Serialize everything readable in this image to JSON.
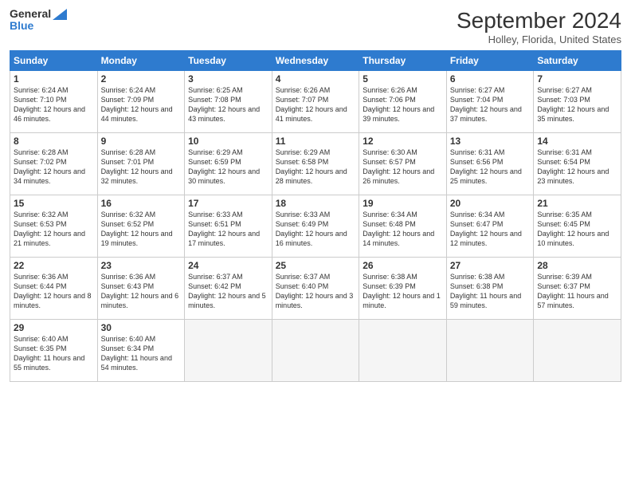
{
  "logo": {
    "line1": "General",
    "line2": "Blue"
  },
  "title": "September 2024",
  "location": "Holley, Florida, United States",
  "days_of_week": [
    "Sunday",
    "Monday",
    "Tuesday",
    "Wednesday",
    "Thursday",
    "Friday",
    "Saturday"
  ],
  "weeks": [
    [
      {
        "day": "1",
        "sunrise": "6:24 AM",
        "sunset": "7:10 PM",
        "daylight": "12 hours and 46 minutes."
      },
      {
        "day": "2",
        "sunrise": "6:24 AM",
        "sunset": "7:09 PM",
        "daylight": "12 hours and 44 minutes."
      },
      {
        "day": "3",
        "sunrise": "6:25 AM",
        "sunset": "7:08 PM",
        "daylight": "12 hours and 43 minutes."
      },
      {
        "day": "4",
        "sunrise": "6:26 AM",
        "sunset": "7:07 PM",
        "daylight": "12 hours and 41 minutes."
      },
      {
        "day": "5",
        "sunrise": "6:26 AM",
        "sunset": "7:06 PM",
        "daylight": "12 hours and 39 minutes."
      },
      {
        "day": "6",
        "sunrise": "6:27 AM",
        "sunset": "7:04 PM",
        "daylight": "12 hours and 37 minutes."
      },
      {
        "day": "7",
        "sunrise": "6:27 AM",
        "sunset": "7:03 PM",
        "daylight": "12 hours and 35 minutes."
      }
    ],
    [
      {
        "day": "8",
        "sunrise": "6:28 AM",
        "sunset": "7:02 PM",
        "daylight": "12 hours and 34 minutes."
      },
      {
        "day": "9",
        "sunrise": "6:28 AM",
        "sunset": "7:01 PM",
        "daylight": "12 hours and 32 minutes."
      },
      {
        "day": "10",
        "sunrise": "6:29 AM",
        "sunset": "6:59 PM",
        "daylight": "12 hours and 30 minutes."
      },
      {
        "day": "11",
        "sunrise": "6:29 AM",
        "sunset": "6:58 PM",
        "daylight": "12 hours and 28 minutes."
      },
      {
        "day": "12",
        "sunrise": "6:30 AM",
        "sunset": "6:57 PM",
        "daylight": "12 hours and 26 minutes."
      },
      {
        "day": "13",
        "sunrise": "6:31 AM",
        "sunset": "6:56 PM",
        "daylight": "12 hours and 25 minutes."
      },
      {
        "day": "14",
        "sunrise": "6:31 AM",
        "sunset": "6:54 PM",
        "daylight": "12 hours and 23 minutes."
      }
    ],
    [
      {
        "day": "15",
        "sunrise": "6:32 AM",
        "sunset": "6:53 PM",
        "daylight": "12 hours and 21 minutes."
      },
      {
        "day": "16",
        "sunrise": "6:32 AM",
        "sunset": "6:52 PM",
        "daylight": "12 hours and 19 minutes."
      },
      {
        "day": "17",
        "sunrise": "6:33 AM",
        "sunset": "6:51 PM",
        "daylight": "12 hours and 17 minutes."
      },
      {
        "day": "18",
        "sunrise": "6:33 AM",
        "sunset": "6:49 PM",
        "daylight": "12 hours and 16 minutes."
      },
      {
        "day": "19",
        "sunrise": "6:34 AM",
        "sunset": "6:48 PM",
        "daylight": "12 hours and 14 minutes."
      },
      {
        "day": "20",
        "sunrise": "6:34 AM",
        "sunset": "6:47 PM",
        "daylight": "12 hours and 12 minutes."
      },
      {
        "day": "21",
        "sunrise": "6:35 AM",
        "sunset": "6:45 PM",
        "daylight": "12 hours and 10 minutes."
      }
    ],
    [
      {
        "day": "22",
        "sunrise": "6:36 AM",
        "sunset": "6:44 PM",
        "daylight": "12 hours and 8 minutes."
      },
      {
        "day": "23",
        "sunrise": "6:36 AM",
        "sunset": "6:43 PM",
        "daylight": "12 hours and 6 minutes."
      },
      {
        "day": "24",
        "sunrise": "6:37 AM",
        "sunset": "6:42 PM",
        "daylight": "12 hours and 5 minutes."
      },
      {
        "day": "25",
        "sunrise": "6:37 AM",
        "sunset": "6:40 PM",
        "daylight": "12 hours and 3 minutes."
      },
      {
        "day": "26",
        "sunrise": "6:38 AM",
        "sunset": "6:39 PM",
        "daylight": "12 hours and 1 minute."
      },
      {
        "day": "27",
        "sunrise": "6:38 AM",
        "sunset": "6:38 PM",
        "daylight": "11 hours and 59 minutes."
      },
      {
        "day": "28",
        "sunrise": "6:39 AM",
        "sunset": "6:37 PM",
        "daylight": "11 hours and 57 minutes."
      }
    ],
    [
      {
        "day": "29",
        "sunrise": "6:40 AM",
        "sunset": "6:35 PM",
        "daylight": "11 hours and 55 minutes."
      },
      {
        "day": "30",
        "sunrise": "6:40 AM",
        "sunset": "6:34 PM",
        "daylight": "11 hours and 54 minutes."
      },
      null,
      null,
      null,
      null,
      null
    ]
  ]
}
